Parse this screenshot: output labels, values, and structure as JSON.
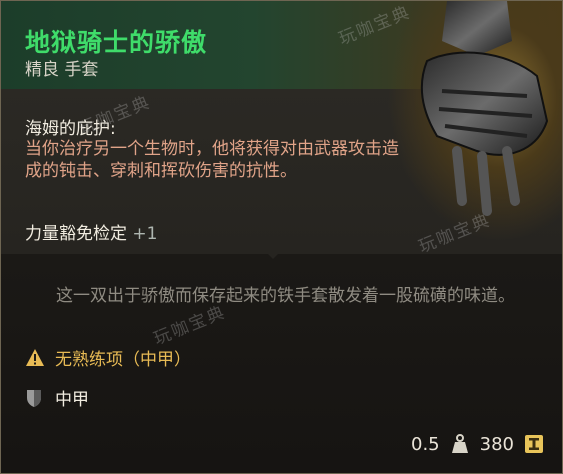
{
  "item": {
    "name": "地狱骑士的骄傲",
    "rarity_type": "精良 手套",
    "name_color": "#3fdc6a"
  },
  "ability": {
    "name": "海姆的庇护:",
    "description": "当你治疗另一个生物时，他将获得对由武器攻击造成的钝击、穿刺和挥砍伤害的抗性。"
  },
  "saving_throw": {
    "label": "力量豁免检定",
    "bonus": "+1"
  },
  "flavor_text": "这一双出于骄傲而保存起来的铁手套散发着一股硫磺的味道。",
  "proficiency": {
    "icon": "warning-icon",
    "text": "无熟练项（中甲）",
    "color": "#e8bb55"
  },
  "armor_type": {
    "icon": "shield-icon",
    "text": "中甲"
  },
  "footer": {
    "weight": "0.5",
    "weight_icon": "weight-icon",
    "value": "380",
    "value_icon": "gold-coin-icon"
  },
  "watermarks": [
    "玩咖宝典",
    "玩咖宝典",
    "玩咖宝典",
    "玩咖宝典"
  ]
}
